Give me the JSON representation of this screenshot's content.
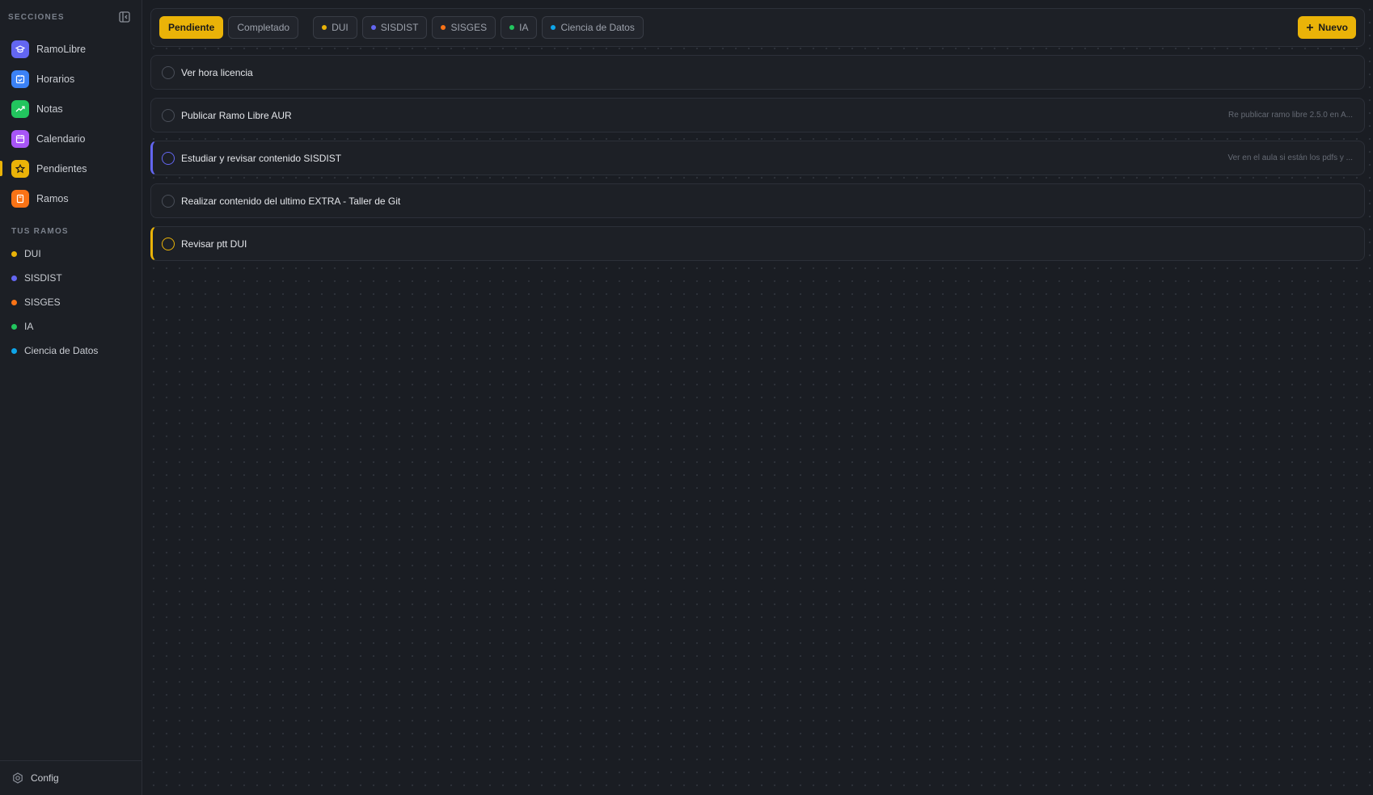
{
  "sidebar": {
    "section_label": "SECCIONES",
    "items": [
      {
        "label": "RamoLibre",
        "icon": "graduation-cap-icon",
        "color": "#6366f1"
      },
      {
        "label": "Horarios",
        "icon": "calendar-check-icon",
        "color": "#3b82f6"
      },
      {
        "label": "Notas",
        "icon": "trending-up-icon",
        "color": "#22c55e"
      },
      {
        "label": "Calendario",
        "icon": "calendar-icon",
        "color": "#a855f7"
      },
      {
        "label": "Pendientes",
        "icon": "star-icon",
        "color": "#eab308",
        "active": true
      },
      {
        "label": "Ramos",
        "icon": "book-icon",
        "color": "#f97316"
      }
    ],
    "ramos_label": "TUS RAMOS",
    "ramos": [
      {
        "label": "DUI",
        "color": "#eab308"
      },
      {
        "label": "SISDIST",
        "color": "#6366f1"
      },
      {
        "label": "SISGES",
        "color": "#f97316"
      },
      {
        "label": "IA",
        "color": "#22c55e"
      },
      {
        "label": "Ciencia de Datos",
        "color": "#0ea5e9"
      }
    ],
    "config_label": "Config"
  },
  "toolbar": {
    "status_tabs": [
      {
        "label": "Pendiente",
        "active": true
      },
      {
        "label": "Completado",
        "active": false
      }
    ],
    "filters": [
      {
        "label": "DUI",
        "color": "#eab308"
      },
      {
        "label": "SISDIST",
        "color": "#6366f1"
      },
      {
        "label": "SISGES",
        "color": "#f97316"
      },
      {
        "label": "IA",
        "color": "#22c55e"
      },
      {
        "label": "Ciencia de Datos",
        "color": "#0ea5e9"
      }
    ],
    "new_label": "Nuevo"
  },
  "tasks": [
    {
      "title": "Ver hora licencia",
      "desc": "",
      "accent": ""
    },
    {
      "title": "Publicar Ramo Libre AUR",
      "desc": "Re publicar ramo libre 2.5.0 en A...",
      "accent": ""
    },
    {
      "title": "Estudiar y revisar contenido SISDIST",
      "desc": "Ver en el aula si están los pdfs y ...",
      "accent": "purple"
    },
    {
      "title": "Realizar contenido del ultimo EXTRA - Taller de Git",
      "desc": "",
      "accent": ""
    },
    {
      "title": "Revisar ptt DUI",
      "desc": "",
      "accent": "yellow"
    }
  ]
}
